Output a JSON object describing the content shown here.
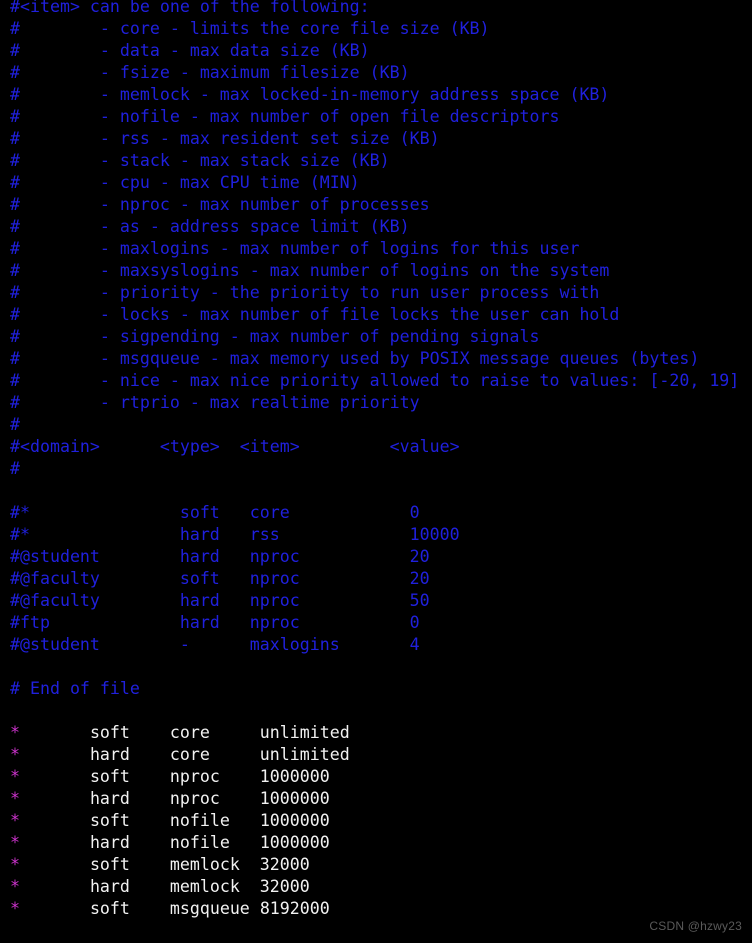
{
  "terminal": {
    "background_color": "#000000",
    "comment_color": "#2020dd",
    "domain_color": "#cc33cc",
    "text_color": "#f2f2f2",
    "watermark_color": "#5a5a5a"
  },
  "watermark": {
    "text": "CSDN @hzwy23"
  },
  "comment_lines": [
    "#<item> can be one of the following:",
    "#        - core - limits the core file size (KB)",
    "#        - data - max data size (KB)",
    "#        - fsize - maximum filesize (KB)",
    "#        - memlock - max locked-in-memory address space (KB)",
    "#        - nofile - max number of open file descriptors",
    "#        - rss - max resident set size (KB)",
    "#        - stack - max stack size (KB)",
    "#        - cpu - max CPU time (MIN)",
    "#        - nproc - max number of processes",
    "#        - as - address space limit (KB)",
    "#        - maxlogins - max number of logins for this user",
    "#        - maxsyslogins - max number of logins on the system",
    "#        - priority - the priority to run user process with",
    "#        - locks - max number of file locks the user can hold",
    "#        - sigpending - max number of pending signals",
    "#        - msgqueue - max memory used by POSIX message queues (bytes)",
    "#        - nice - max nice priority allowed to raise to values: [-20, 19]",
    "#        - rtprio - max realtime priority",
    "#"
  ],
  "header_line": "#<domain>      <type>  <item>         <value>",
  "header_spacer": "#",
  "example_rules": [
    "#*               soft   core            0",
    "#*               hard   rss             10000",
    "#@student        hard   nproc           20",
    "#@faculty        soft   nproc           20",
    "#@faculty        hard   nproc           50",
    "#ftp             hard   nproc           0",
    "#@student        -      maxlogins       4"
  ],
  "end_of_file_comment": "# End of file",
  "active_rules": [
    {
      "domain": "*",
      "gap1": "       ",
      "type": "soft",
      "gap2": "    ",
      "item": "core",
      "gap3": "     ",
      "value": "unlimited"
    },
    {
      "domain": "*",
      "gap1": "       ",
      "type": "hard",
      "gap2": "    ",
      "item": "core",
      "gap3": "     ",
      "value": "unlimited"
    },
    {
      "domain": "*",
      "gap1": "       ",
      "type": "soft",
      "gap2": "    ",
      "item": "nproc",
      "gap3": "    ",
      "value": "1000000"
    },
    {
      "domain": "*",
      "gap1": "       ",
      "type": "hard",
      "gap2": "    ",
      "item": "nproc",
      "gap3": "    ",
      "value": "1000000"
    },
    {
      "domain": "*",
      "gap1": "       ",
      "type": "soft",
      "gap2": "    ",
      "item": "nofile",
      "gap3": "   ",
      "value": "1000000"
    },
    {
      "domain": "*",
      "gap1": "       ",
      "type": "hard",
      "gap2": "    ",
      "item": "nofile",
      "gap3": "   ",
      "value": "1000000"
    },
    {
      "domain": "*",
      "gap1": "       ",
      "type": "soft",
      "gap2": "    ",
      "item": "memlock",
      "gap3": "  ",
      "value": "32000"
    },
    {
      "domain": "*",
      "gap1": "       ",
      "type": "hard",
      "gap2": "    ",
      "item": "memlock",
      "gap3": "  ",
      "value": "32000"
    },
    {
      "domain": "*",
      "gap1": "       ",
      "type": "soft",
      "gap2": "    ",
      "item": "msgqueue",
      "gap3": " ",
      "value": "8192000"
    }
  ]
}
